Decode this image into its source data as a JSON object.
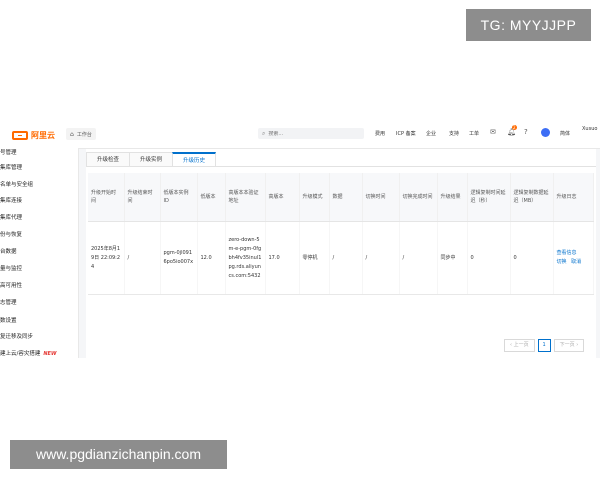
{
  "watermarks": {
    "top": "TG: MYYJJPP",
    "bottom": "www.pgdianzichanpin.com"
  },
  "header": {
    "logo_text": "阿里云",
    "workbench": "工作台",
    "search_placeholder": "搜索...",
    "nav": [
      "费用",
      "ICP 备案",
      "企业",
      "支持",
      "工单"
    ],
    "notification_count": "2",
    "language": "简体",
    "user": "Xusuo"
  },
  "sidebar": {
    "items": [
      "号管理",
      "集库管理",
      "名单与安全组",
      "集库连接",
      "集库代理",
      "份与恢复",
      "台数据",
      "量与监控",
      "高可用性",
      "志管理",
      "数设置",
      "复迁移及同步",
      "建上云/容灾搭建"
    ],
    "new_badge": "NEW"
  },
  "tabs": [
    "升级检查",
    "升级实例",
    "升级历史"
  ],
  "active_tab": 2,
  "table": {
    "columns": [
      "升级开始时间",
      "升级结束时间",
      "低版本实例ID",
      "低版本",
      "高版本本验证地址",
      "高版本",
      "升级模式",
      "数据",
      "切换时间",
      "切换完成时间",
      "升级结果",
      "逻辑复制时间延迟（秒）",
      "逻辑复制数据延迟（MB）",
      "升级日志"
    ],
    "rows": [
      {
        "start": "2025年8月19日 22:09:24",
        "end": "/",
        "instance_id": "pgm-0jl0916po5io007x",
        "low_version": "12.0",
        "verify_addr": "zero-down-5m-e-pgm-0fgbh4fv35inul1pg.rds.aliyuncs.com:5432",
        "high_version": "17.0",
        "mode": "零停机",
        "data": "/",
        "switch_time": "/",
        "switch_done": "/",
        "result": "同步中",
        "lag_sec": "0",
        "lag_mb": "0",
        "log_link": "查看信息",
        "switch_link": "切换",
        "release_link": "取消"
      }
    ]
  },
  "pager": {
    "prev": "上一页",
    "page": "1",
    "next": "下一页"
  }
}
